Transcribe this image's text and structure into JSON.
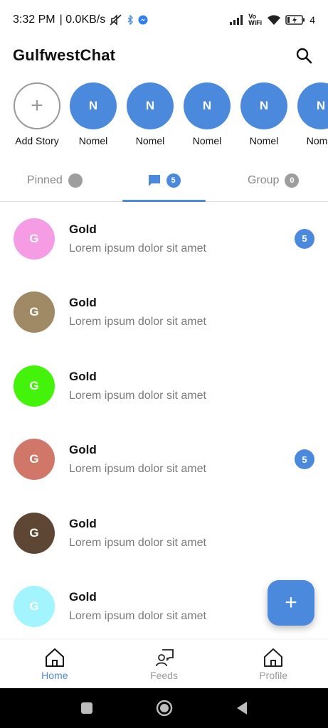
{
  "status_bar": {
    "time": "3:32 PM",
    "network_speed": "| 0.0KB/s",
    "vo_wifi": "Vo WiFi",
    "battery": "4",
    "icons": [
      "silent-icon",
      "bluetooth-icon",
      "messenger-icon",
      "signal-icon",
      "wifi-icon",
      "battery-icon"
    ]
  },
  "header": {
    "title": "GulfwestChat",
    "search_icon": "search-icon"
  },
  "stories": [
    {
      "label": "Add Story",
      "initial": "+",
      "type": "add"
    },
    {
      "label": "Nomel",
      "initial": "N"
    },
    {
      "label": "Nomel",
      "initial": "N"
    },
    {
      "label": "Nomel",
      "initial": "N"
    },
    {
      "label": "Nomel",
      "initial": "N"
    },
    {
      "label": "Nomel",
      "initial": "N"
    }
  ],
  "tabs": [
    {
      "label": "Pinned",
      "badge": "",
      "active": false
    },
    {
      "label": "",
      "icon": "chat-icon",
      "badge": "5",
      "active": true
    },
    {
      "label": "Group",
      "badge": "0",
      "active": false
    }
  ],
  "chats": [
    {
      "initial": "G",
      "name": "Gold",
      "message": "Lorem ipsum dolor sit amet",
      "unread": "5",
      "color": "#f59ce5"
    },
    {
      "initial": "G",
      "name": "Gold",
      "message": "Lorem ipsum dolor sit amet",
      "unread": "",
      "color": "#a08a66"
    },
    {
      "initial": "G",
      "name": "Gold",
      "message": "Lorem ipsum dolor sit amet",
      "unread": "",
      "color": "#44f30a"
    },
    {
      "initial": "G",
      "name": "Gold",
      "message": "Lorem ipsum dolor sit amet",
      "unread": "5",
      "color": "#d1776a"
    },
    {
      "initial": "G",
      "name": "Gold",
      "message": "Lorem ipsum dolor sit amet",
      "unread": "",
      "color": "#5e4634"
    },
    {
      "initial": "G",
      "name": "Gold",
      "message": "Lorem ipsum dolor sit amet",
      "unread": "",
      "color": "#a2f4ff"
    }
  ],
  "fab": {
    "label": "+"
  },
  "bottom_nav": [
    {
      "label": "Home",
      "icon": "home-icon",
      "active": true
    },
    {
      "label": "Feeds",
      "icon": "feeds-icon",
      "active": false
    },
    {
      "label": "Profile",
      "icon": "profile-home-icon",
      "active": false
    }
  ],
  "colors": {
    "accent": "#4a89dc",
    "muted": "#9e9e9e"
  }
}
